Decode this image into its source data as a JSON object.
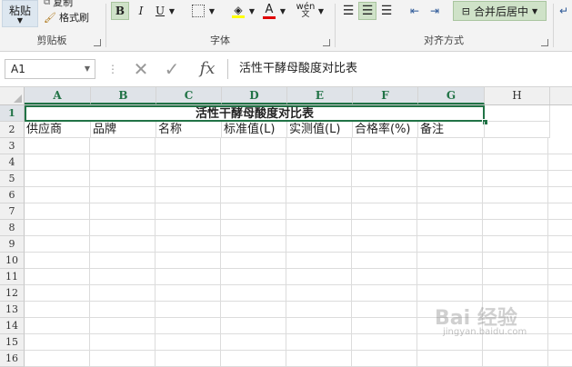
{
  "ribbon": {
    "clipboard": {
      "paste": "粘贴",
      "copy": "复制",
      "format_painter": "格式刷",
      "label": "剪贴板"
    },
    "font": {
      "bold": "B",
      "italic": "I",
      "underline": "U",
      "font_color_letter": "A",
      "phonetic": "wén",
      "label": "字体"
    },
    "alignment": {
      "merge_center": "合并后居中",
      "label": "对齐方式"
    }
  },
  "formula_bar": {
    "name_box": "A1",
    "fx": "fx",
    "content": "活性干酵母酸度对比表"
  },
  "sheet": {
    "columns": [
      "A",
      "B",
      "C",
      "D",
      "E",
      "F",
      "G",
      "H"
    ],
    "rows": [
      "1",
      "2",
      "3",
      "4",
      "5",
      "6",
      "7",
      "8",
      "9",
      "10",
      "11",
      "12",
      "13",
      "14",
      "15",
      "16"
    ],
    "title": "活性干酵母酸度对比表",
    "headers": [
      "供应商",
      "品牌",
      "名称",
      "标准值(L)",
      "实测值(L)",
      "合格率(%)",
      "备注"
    ]
  },
  "watermark": {
    "main": "Bai 经验",
    "sub": "jingyan.baidu.com"
  },
  "colors": {
    "accent": "#217346",
    "selected_header_bg": "#dfe3e8",
    "button_active_bg": "#cfe2c8"
  }
}
